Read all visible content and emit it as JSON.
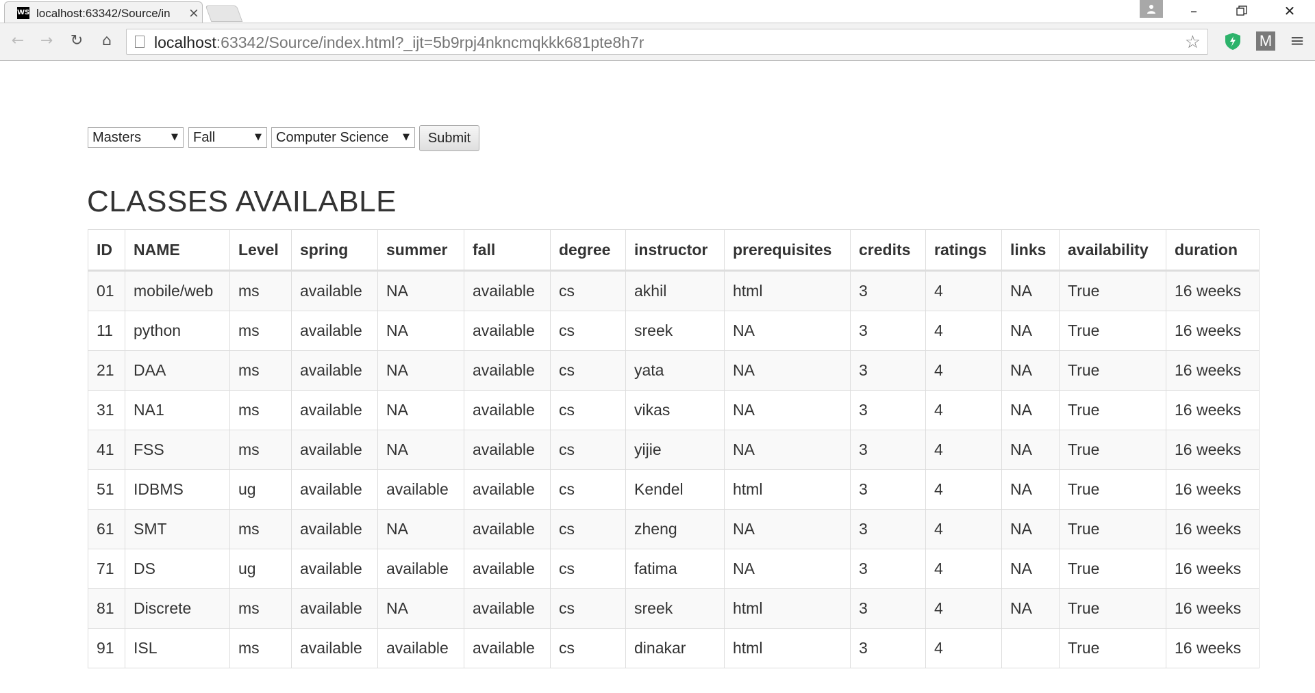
{
  "browser": {
    "tab_title": "localhost:63342/Source/in",
    "favicon_text": "WS",
    "url_host": "localhost",
    "url_rest": ":63342/Source/index.html?_ijt=5b9rpj4nkncmqkkk681pte8h7r"
  },
  "filters": {
    "level_selected": "Masters",
    "term_selected": "Fall",
    "department_selected": "Computer Science",
    "submit_label": "Submit"
  },
  "page": {
    "title": "CLASSES AVAILABLE"
  },
  "table": {
    "headers": [
      "ID",
      "NAME",
      "Level",
      "spring",
      "summer",
      "fall",
      "degree",
      "instructor",
      "prerequisites",
      "credits",
      "ratings",
      "links",
      "availability",
      "duration"
    ],
    "rows": [
      [
        "01",
        "mobile/web",
        "ms",
        "available",
        "NA",
        "available",
        "cs",
        "akhil",
        "html",
        "3",
        "4",
        "NA",
        "True",
        "16 weeks"
      ],
      [
        "11",
        "python",
        "ms",
        "available",
        "NA",
        "available",
        "cs",
        "sreek",
        "NA",
        "3",
        "4",
        "NA",
        "True",
        "16 weeks"
      ],
      [
        "21",
        "DAA",
        "ms",
        "available",
        "NA",
        "available",
        "cs",
        "yata",
        "NA",
        "3",
        "4",
        "NA",
        "True",
        "16 weeks"
      ],
      [
        "31",
        "NA1",
        "ms",
        "available",
        "NA",
        "available",
        "cs",
        "vikas",
        "NA",
        "3",
        "4",
        "NA",
        "True",
        "16 weeks"
      ],
      [
        "41",
        "FSS",
        "ms",
        "available",
        "NA",
        "available",
        "cs",
        "yijie",
        "NA",
        "3",
        "4",
        "NA",
        "True",
        "16 weeks"
      ],
      [
        "51",
        "IDBMS",
        "ug",
        "available",
        "available",
        "available",
        "cs",
        "Kendel",
        "html",
        "3",
        "4",
        "NA",
        "True",
        "16 weeks"
      ],
      [
        "61",
        "SMT",
        "ms",
        "available",
        "NA",
        "available",
        "cs",
        "zheng",
        "NA",
        "3",
        "4",
        "NA",
        "True",
        "16 weeks"
      ],
      [
        "71",
        "DS",
        "ug",
        "available",
        "available",
        "available",
        "cs",
        "fatima",
        "NA",
        "3",
        "4",
        "NA",
        "True",
        "16 weeks"
      ],
      [
        "81",
        "Discrete",
        "ms",
        "available",
        "NA",
        "available",
        "cs",
        "sreek",
        "html",
        "3",
        "4",
        "NA",
        "True",
        "16 weeks"
      ],
      [
        "91",
        "ISL",
        "ms",
        "available",
        "available",
        "available",
        "cs",
        "dinakar",
        "html",
        "3",
        "4",
        "",
        "True",
        "16 weeks"
      ]
    ]
  }
}
